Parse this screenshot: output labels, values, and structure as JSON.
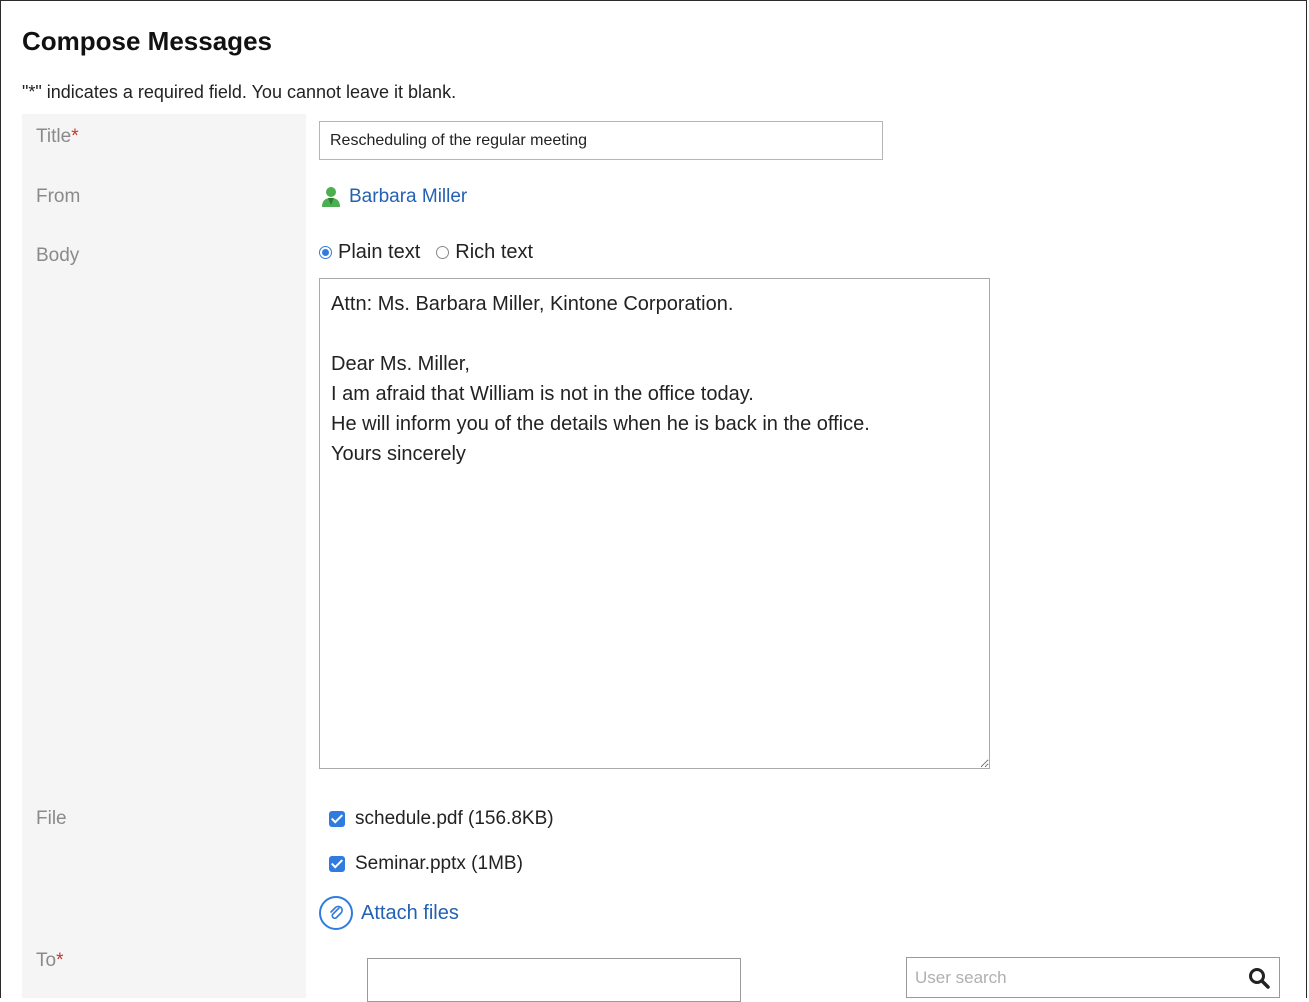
{
  "header": {
    "title": "Compose Messages",
    "required_note": "\"*\" indicates a required field. You cannot leave it blank."
  },
  "labels": {
    "title": "Title",
    "from": "From",
    "body": "Body",
    "file": "File",
    "to": "To",
    "required_mark": "*"
  },
  "form": {
    "title_value": "Rescheduling of the regular meeting",
    "from_name": "Barbara Miller",
    "body_modes": {
      "plain": "Plain text",
      "rich": "Rich text",
      "selected": "plain"
    },
    "body_text": "Attn: Ms. Barbara Miller, Kintone Corporation.\n\nDear Ms. Miller,\nI am afraid that William is not in the office today.\nHe will inform you of the details when he is back in the office.\nYours sincerely",
    "files": [
      {
        "label": "schedule.pdf (156.8KB)",
        "checked": true
      },
      {
        "label": "Seminar.pptx (1MB)",
        "checked": true
      }
    ],
    "attach_label": "Attach files",
    "to_value": "",
    "user_search_placeholder": "User search"
  },
  "colors": {
    "link": "#2461b3",
    "accent": "#2f7be0",
    "label": "#8a8a8a",
    "required": "#c0392b",
    "user_icon": "#4caf50"
  },
  "icons": {
    "from": "user-icon",
    "attach": "paperclip-icon",
    "search": "search-icon"
  }
}
